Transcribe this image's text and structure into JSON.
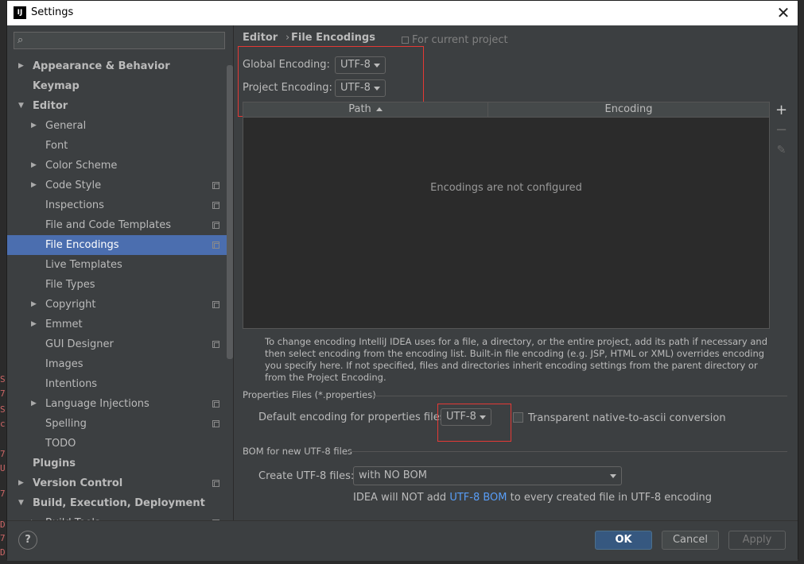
{
  "background_lines": [
    "S",
    "7",
    "S",
    "c",
    "7",
    "U",
    "7",
    "D",
    "7",
    "D"
  ],
  "window": {
    "title": "Settings",
    "app_icon": "IJ",
    "close": "✕"
  },
  "sidebar": {
    "search_placeholder": "",
    "items": [
      {
        "label": "Appearance & Behavior",
        "level": 0,
        "arrow": "▶",
        "bold": true
      },
      {
        "label": "Keymap",
        "level": 0,
        "arrow": "",
        "bold": true
      },
      {
        "label": "Editor",
        "level": 0,
        "arrow": "▼",
        "bold": true
      },
      {
        "label": "General",
        "level": 1,
        "arrow": "▶"
      },
      {
        "label": "Font",
        "level": 1,
        "arrow": ""
      },
      {
        "label": "Color Scheme",
        "level": 1,
        "arrow": "▶"
      },
      {
        "label": "Code Style",
        "level": 1,
        "arrow": "▶",
        "project": true
      },
      {
        "label": "Inspections",
        "level": 1,
        "arrow": "",
        "project": true
      },
      {
        "label": "File and Code Templates",
        "level": 1,
        "arrow": "",
        "project": true
      },
      {
        "label": "File Encodings",
        "level": 1,
        "arrow": "",
        "project": true,
        "selected": true
      },
      {
        "label": "Live Templates",
        "level": 1,
        "arrow": ""
      },
      {
        "label": "File Types",
        "level": 1,
        "arrow": ""
      },
      {
        "label": "Copyright",
        "level": 1,
        "arrow": "▶",
        "project": true
      },
      {
        "label": "Emmet",
        "level": 1,
        "arrow": "▶"
      },
      {
        "label": "GUI Designer",
        "level": 1,
        "arrow": "",
        "project": true
      },
      {
        "label": "Images",
        "level": 1,
        "arrow": ""
      },
      {
        "label": "Intentions",
        "level": 1,
        "arrow": ""
      },
      {
        "label": "Language Injections",
        "level": 1,
        "arrow": "▶",
        "project": true
      },
      {
        "label": "Spelling",
        "level": 1,
        "arrow": "",
        "project": true
      },
      {
        "label": "TODO",
        "level": 1,
        "arrow": ""
      },
      {
        "label": "Plugins",
        "level": 0,
        "arrow": "",
        "bold": true
      },
      {
        "label": "Version Control",
        "level": 0,
        "arrow": "▶",
        "bold": true,
        "project": true
      },
      {
        "label": "Build, Execution, Deployment",
        "level": 0,
        "arrow": "▼",
        "bold": true
      },
      {
        "label": "Build Tools",
        "level": 1,
        "arrow": "▶",
        "project": true
      }
    ]
  },
  "main": {
    "breadcrumb": {
      "parent": "Editor",
      "separator": "›",
      "current": "File Encodings"
    },
    "for_current_project": "For current project",
    "global_encoding": {
      "label": "Global Encoding:",
      "value": "UTF-8"
    },
    "project_encoding": {
      "label": "Project Encoding:",
      "value": "UTF-8"
    },
    "table": {
      "col_path": "Path",
      "col_encoding": "Encoding",
      "empty_text": "Encodings are not configured"
    },
    "tools": {
      "add": "+",
      "remove": "−",
      "edit": "✎"
    },
    "help_text": "To change encoding IntelliJ IDEA uses for a file, a directory, or the entire project, add its path if necessary and then select encoding from the encoding list. Built-in file encoding (e.g. JSP, HTML or XML) overrides encoding you specify here. If not specified, files and directories inherit encoding settings from the parent directory or from the Project Encoding.",
    "properties": {
      "section": "Properties Files (*.properties)",
      "default_label": "Default encoding for properties files:",
      "default_value": "UTF-8",
      "transparent_label": "Transparent native-to-ascii conversion",
      "transparent_checked": false
    },
    "bom": {
      "section": "BOM for new UTF-8 files",
      "create_label": "Create UTF-8 files:",
      "create_value": "with NO BOM",
      "note_prefix": "IDEA will NOT add ",
      "note_link": "UTF-8 BOM",
      "note_suffix": " to every created file in UTF-8 encoding"
    }
  },
  "footer": {
    "help": "?",
    "ok": "OK",
    "cancel": "Cancel",
    "apply": "Apply"
  },
  "colors": {
    "selection": "#4b6eaf",
    "link": "#589df6",
    "highlight_box": "#e53935",
    "ok_button": "#365880"
  }
}
